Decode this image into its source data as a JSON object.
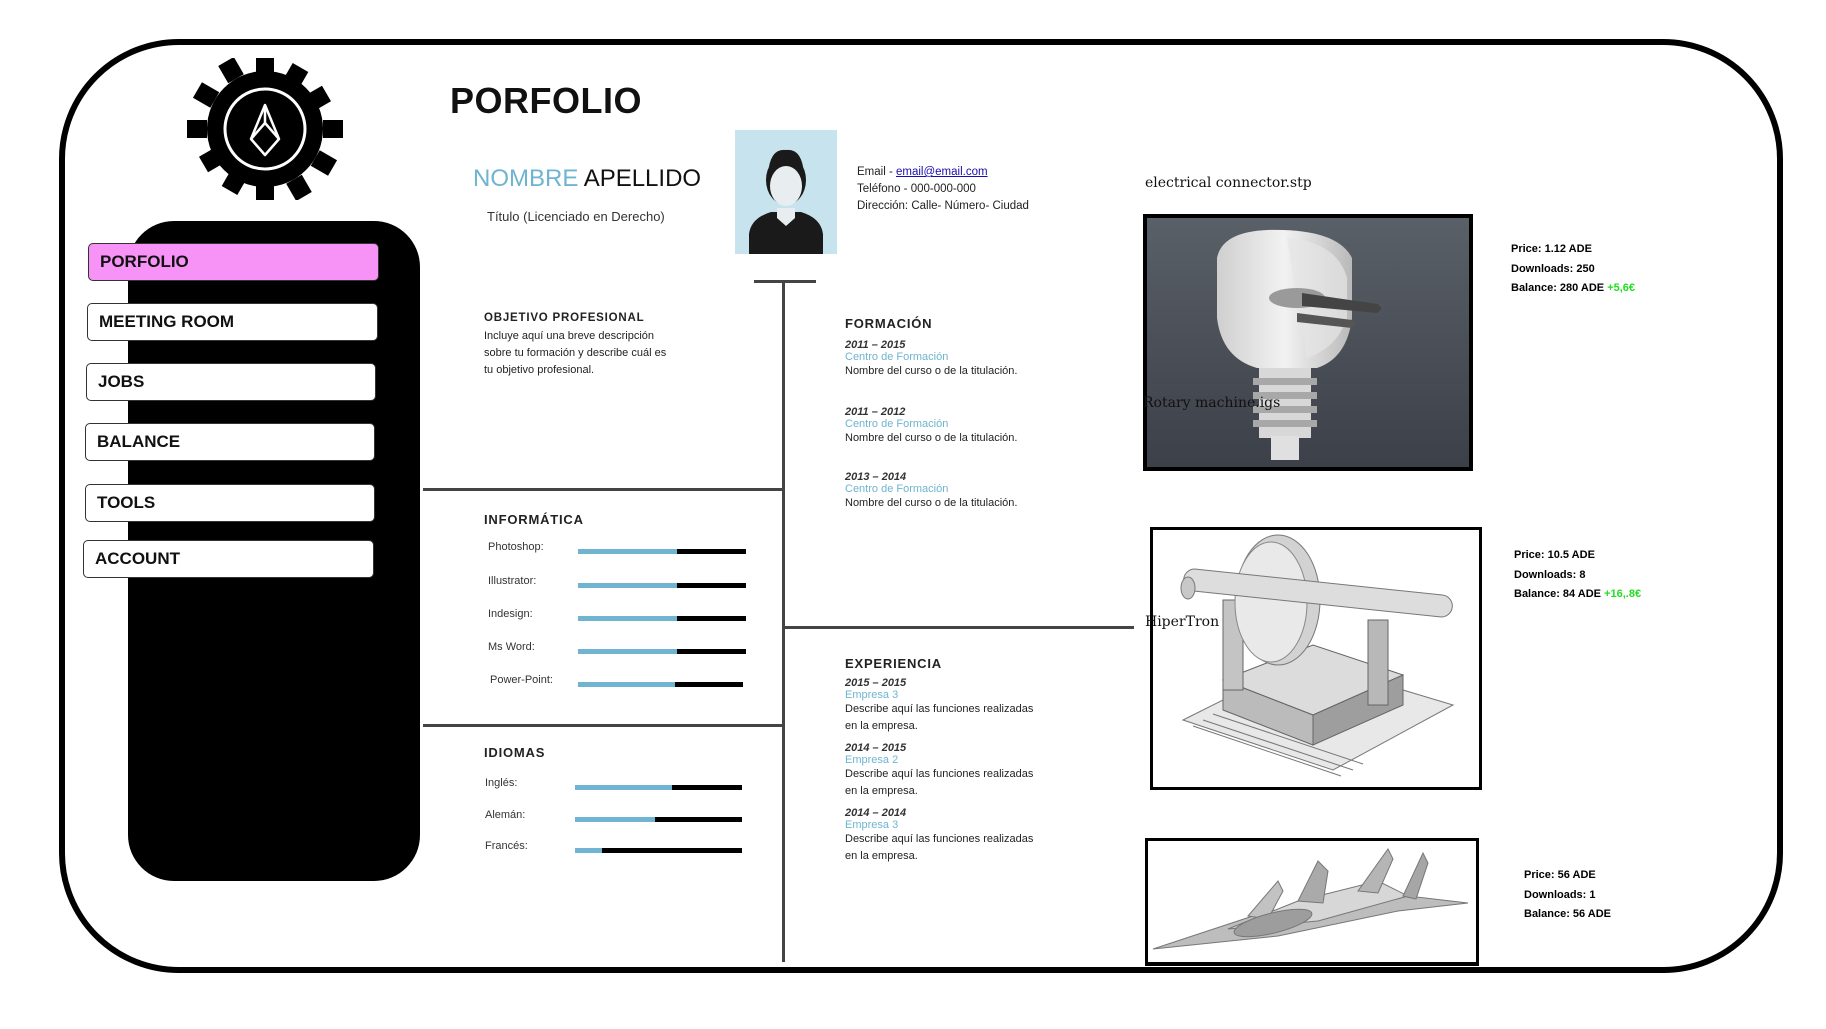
{
  "page": {
    "title": "PORFOLIO"
  },
  "nav": {
    "items": [
      {
        "label": "PORFOLIO",
        "active": true
      },
      {
        "label": "MEETING ROOM",
        "active": false
      },
      {
        "label": "JOBS",
        "active": false
      },
      {
        "label": "BALANCE",
        "active": false
      },
      {
        "label": "TOOLS",
        "active": false
      },
      {
        "label": "ACCOUNT",
        "active": false
      }
    ]
  },
  "cv": {
    "first_name": "NOMBRE",
    "last_name": "APELLIDO",
    "titulo": "Título (Licenciado en Derecho)",
    "contact": {
      "email_label": "Email -",
      "email": "email@email.com",
      "phone": "Teléfono - 000-000-000",
      "address": "Dirección: Calle- Número- Ciudad"
    },
    "objetivo": {
      "heading": "OBJETIVO PROFESIONAL",
      "lines": [
        "Incluye aquí una breve descripción",
        "sobre tu formación y describe cuál es",
        "tu objetivo profesional."
      ]
    },
    "informatica": {
      "heading": "INFORMÁTICA",
      "skills": [
        {
          "name": "Photoshop:",
          "level": 0.59
        },
        {
          "name": "Illustrator:",
          "level": 0.59
        },
        {
          "name": "Indesign:",
          "level": 0.59
        },
        {
          "name": "Ms Word:",
          "level": 0.59
        },
        {
          "name": "Power-Point:",
          "level": 0.59
        }
      ]
    },
    "idiomas": {
      "heading": "IDIOMAS",
      "skills": [
        {
          "name": "Inglés:",
          "level": 0.58
        },
        {
          "name": "Alemán:",
          "level": 0.48
        },
        {
          "name": "Francés:",
          "level": 0.16
        }
      ]
    },
    "formacion": {
      "heading": "FORMACIÓN",
      "entries": [
        {
          "date": "2011 – 2015",
          "inst": "Centro de Formación",
          "desc": "Nombre del curso o de la titulación."
        },
        {
          "date": "2011 – 2012",
          "inst": "Centro de Formación",
          "desc": "Nombre del curso o de la titulación."
        },
        {
          "date": "2013 – 2014",
          "inst": "Centro de Formación",
          "desc": "Nombre del curso o de la titulación."
        }
      ]
    },
    "experiencia": {
      "heading": "EXPERIENCIA",
      "entries": [
        {
          "date": "2015 – 2015",
          "inst": "Empresa 3",
          "desc1": "Describe aquí las funciones realizadas",
          "desc2": "en la empresa."
        },
        {
          "date": "2014 – 2015",
          "inst": "Empresa 2",
          "desc1": "Describe aquí las funciones realizadas",
          "desc2": "en la empresa."
        },
        {
          "date": "2014 – 2014",
          "inst": "Empresa 3",
          "desc1": "Describe aquí las funciones realizadas",
          "desc2": "en la empresa."
        }
      ]
    }
  },
  "models": [
    {
      "title": "electrical connector.stp",
      "overlay": "Rotary machine.igs",
      "price": "Price: 1.12 ADE",
      "downloads": "Downloads: 250",
      "balance": "Balance: 280 ADE",
      "change": "+5,6€"
    },
    {
      "title": "",
      "overlay": "HiperTron",
      "price": "Price: 10.5 ADE",
      "downloads": "Downloads: 8",
      "balance": "Balance: 84 ADE",
      "change": "+16,.8€"
    },
    {
      "title": "",
      "overlay": "",
      "price": "Price: 56 ADE",
      "downloads": "Downloads: 1",
      "balance": "Balance: 56 ADE",
      "change": ""
    }
  ],
  "colors": {
    "accent_pink": "#f792f7",
    "cv_blue": "#6fb4d0",
    "positive": "#22dd22"
  }
}
